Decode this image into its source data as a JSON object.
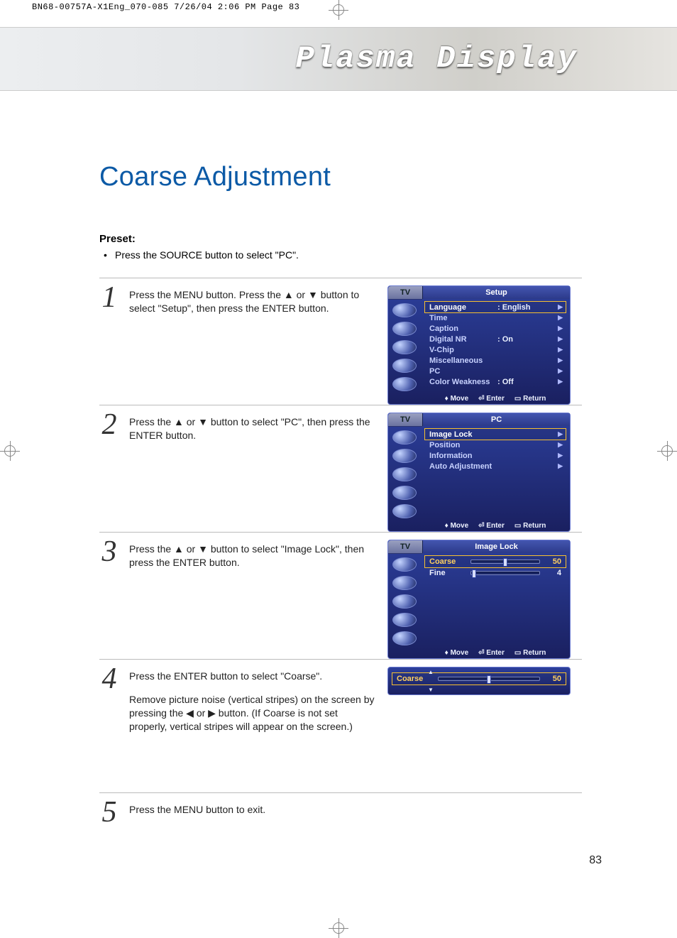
{
  "print_header": "BN68-00757A-X1Eng_070-085  7/26/04  2:06 PM  Page 83",
  "banner_title": "Plasma Display",
  "page_title": "Coarse Adjustment",
  "preset_label": "Preset:",
  "preset_bullet": "Press the SOURCE button to select \"PC\".",
  "page_number": "83",
  "steps": {
    "s1": {
      "num": "1",
      "text": "Press the MENU button. Press the ▲ or ▼ button to select \"Setup\", then press the ENTER button."
    },
    "s2": {
      "num": "2",
      "text": "Press the ▲ or ▼ button to select \"PC\", then press the ENTER button."
    },
    "s3": {
      "num": "3",
      "text": "Press the ▲ or ▼ button to select \"Image Lock\", then press the ENTER button."
    },
    "s4": {
      "num": "4",
      "text_a": "Press the ENTER button to select \"Coarse\".",
      "text_b": "Remove picture noise (vertical stripes) on the screen by pressing the ◀ or ▶ button. (If Coarse is not set properly, vertical stripes will appear on the screen.)"
    },
    "s5": {
      "num": "5",
      "text": "Press the MENU button to exit."
    }
  },
  "osd_footer": {
    "move": "Move",
    "enter": "Enter",
    "return": "Return"
  },
  "osd1": {
    "tv": "TV",
    "title": "Setup",
    "rows": [
      {
        "label": "Language",
        "val": ": English"
      },
      {
        "label": "Time",
        "val": ""
      },
      {
        "label": "Caption",
        "val": ""
      },
      {
        "label": "Digital NR",
        "val": ": On"
      },
      {
        "label": "V-Chip",
        "val": ""
      },
      {
        "label": "Miscellaneous",
        "val": ""
      },
      {
        "label": "PC",
        "val": ""
      },
      {
        "label": "Color Weakness",
        "val": ": Off"
      }
    ]
  },
  "osd2": {
    "tv": "TV",
    "title": "PC",
    "rows": [
      {
        "label": "Image Lock"
      },
      {
        "label": "Position"
      },
      {
        "label": "Information"
      },
      {
        "label": "Auto Adjustment"
      }
    ]
  },
  "osd3": {
    "tv": "TV",
    "title": "Image Lock",
    "sliders": [
      {
        "label": "Coarse",
        "val": "50",
        "pos": 50
      },
      {
        "label": "Fine",
        "val": "4",
        "pos": 4
      }
    ]
  },
  "osd4": {
    "label": "Coarse",
    "val": "50",
    "pos": 50
  }
}
